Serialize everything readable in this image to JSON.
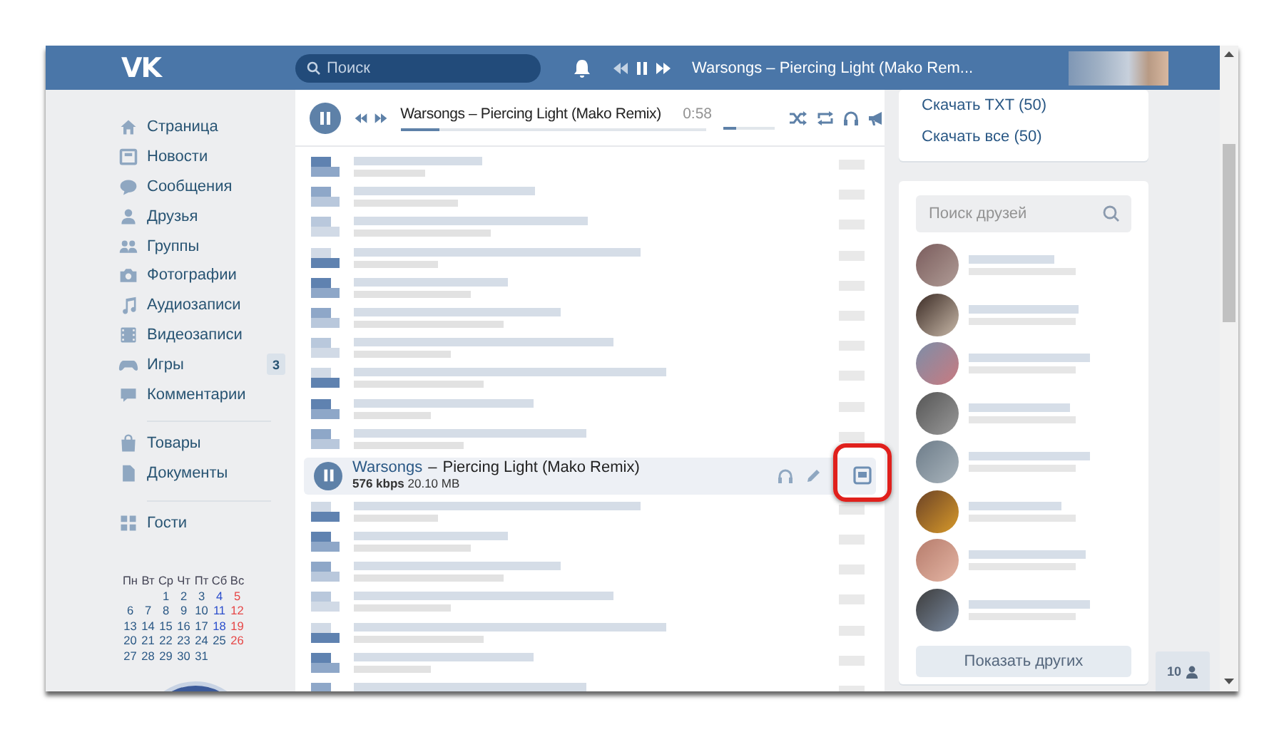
{
  "header": {
    "logo": "VK",
    "search": {
      "placeholder": "Поиск"
    },
    "now_playing": "Warsongs – Piercing Light (Mako Rem...",
    "playing": true
  },
  "sidebar": {
    "sections": [
      [
        {
          "label": "Страница"
        },
        {
          "label": "Новости"
        },
        {
          "label": "Сообщения"
        },
        {
          "label": "Друзья"
        },
        {
          "label": "Группы"
        },
        {
          "label": "Фотографии"
        },
        {
          "label": "Аудиозаписи"
        },
        {
          "label": "Видеозаписи"
        },
        {
          "label": "Игры",
          "badge": "3"
        },
        {
          "label": "Комментарии"
        }
      ],
      [
        {
          "label": "Товары"
        },
        {
          "label": "Документы"
        }
      ],
      [
        {
          "label": "Гости"
        }
      ]
    ]
  },
  "calendar": {
    "weekdays": [
      "Пн",
      "Вт",
      "Ср",
      "Чт",
      "Пт",
      "Сб",
      "Вс"
    ],
    "weeks": [
      [
        {
          "day": "1",
          "kind": "weekday"
        },
        {
          "day": "2",
          "kind": "weekday"
        },
        {
          "day": "3",
          "kind": "weekday"
        },
        {
          "day": "4",
          "kind": "saturday"
        },
        {
          "day": "5",
          "kind": "sunday"
        }
      ],
      [
        {
          "day": "6",
          "kind": "weekday"
        },
        {
          "day": "7",
          "kind": "weekday"
        },
        {
          "day": "8",
          "kind": "weekday"
        },
        {
          "day": "9",
          "kind": "weekday"
        },
        {
          "day": "10",
          "kind": "weekday"
        },
        {
          "day": "11",
          "kind": "saturday"
        },
        {
          "day": "12",
          "kind": "sunday"
        }
      ],
      [
        {
          "day": "13",
          "kind": "weekday"
        },
        {
          "day": "14",
          "kind": "weekday"
        },
        {
          "day": "15",
          "kind": "weekday"
        },
        {
          "day": "16",
          "kind": "weekday"
        },
        {
          "day": "17",
          "kind": "weekday"
        },
        {
          "day": "18",
          "kind": "saturday"
        },
        {
          "day": "19",
          "kind": "sunday"
        }
      ],
      [
        {
          "day": "20",
          "kind": "weekday"
        },
        {
          "day": "21",
          "kind": "weekday"
        },
        {
          "day": "22",
          "kind": "weekday"
        },
        {
          "day": "23",
          "kind": "weekday"
        },
        {
          "day": "24",
          "kind": "weekday"
        },
        {
          "day": "25",
          "kind": "weekday"
        },
        {
          "day": "26",
          "kind": "sunday"
        }
      ],
      [
        {
          "day": "27",
          "kind": "weekday"
        },
        {
          "day": "28",
          "kind": "weekday"
        },
        {
          "day": "29",
          "kind": "weekday"
        },
        {
          "day": "30",
          "kind": "weekday"
        },
        {
          "day": "31",
          "kind": "weekday"
        }
      ]
    ]
  },
  "player": {
    "playing": true,
    "title": "Warsongs – Piercing Light (Mako Remix)",
    "time": "0:58",
    "progress": {
      "level": 0.13
    },
    "volume": {
      "level": 0.25
    }
  },
  "current_track": {
    "playing": true,
    "artist": "Warsongs",
    "separator": "–",
    "title": "Piercing Light (Mako Remix)",
    "info": "**576 kbps** 20.10 MB"
  },
  "downloads": [
    "Скачать TXT (50)",
    "Скачать все (50)"
  ],
  "friends": {
    "search": {
      "placeholder": "Поиск друзей"
    },
    "show_more": "Показать других"
  },
  "online_badge": "10"
}
